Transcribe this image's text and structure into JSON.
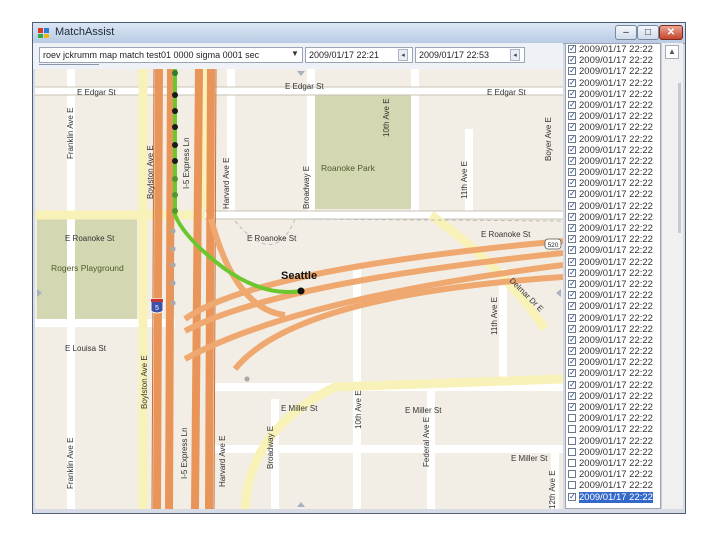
{
  "window": {
    "title": "MatchAssist"
  },
  "controls": {
    "file_combo_value": "roev jckrumm map match test01 0000 sigma 0001 sec",
    "start_time": "2009/01/17 22:21",
    "end_time": "2009/01/17 22:53",
    "minimize": "–",
    "maximize": "□",
    "close": "✕",
    "combo_arrow": "▼",
    "spin": "◂",
    "scroll_up": "▲"
  },
  "map_labels": {
    "e_edgar_st_1": "E Edgar St",
    "e_edgar_st_2": "E Edgar St",
    "e_edgar_st_3": "E Edgar St",
    "franklin_ave_e_1": "Franklin Ave E",
    "franklin_ave_e_2": "Franklin Ave E",
    "boylston_ave_e_1": "Boylston Ave E",
    "boylston_ave_e_2": "Boylston Ave E",
    "i5_express_ln_1": "I-5 Express Ln",
    "i5_express_ln_2": "I-5 Express Ln",
    "harvard_ave_e_1": "Harvard Ave E",
    "harvard_ave_e_2": "Harvard Ave E",
    "broadway_e_1": "Broadway E",
    "broadway_e_2": "Broadway E",
    "tenth_ave_e_1": "10th Ave E",
    "tenth_ave_e_2": "10th Ave E",
    "eleventh_ave_e_1": "11th Ave E",
    "eleventh_ave_e_2": "11th Ave E",
    "boyer_ave_e": "Boyer Ave E",
    "roanoke_park": "Roanoke Park",
    "e_roanoke_st_1": "E Roanoke St",
    "e_roanoke_st_2": "E Roanoke St",
    "e_roanoke_st_3": "E Roanoke St",
    "rogers_playground": "Rogers Playground",
    "seattle": "Seattle",
    "e_louisa_st": "E Louisa St",
    "e_miller_st_1": "E Miller St",
    "e_miller_st_2": "E Miller St",
    "e_miller_st_3": "E Miller St",
    "federal_ave_e": "Federal Ave E",
    "twelfth_ave_e": "12th Ave E",
    "delmar_dr_e": "Delmar Dr E",
    "sr520": "520",
    "i5": "5"
  },
  "timestamps": [
    {
      "label": "2009/01/17 22:22",
      "checked": true
    },
    {
      "label": "2009/01/17 22:22",
      "checked": true
    },
    {
      "label": "2009/01/17 22:22",
      "checked": true
    },
    {
      "label": "2009/01/17 22:22",
      "checked": true
    },
    {
      "label": "2009/01/17 22:22",
      "checked": true
    },
    {
      "label": "2009/01/17 22:22",
      "checked": true
    },
    {
      "label": "2009/01/17 22:22",
      "checked": true
    },
    {
      "label": "2009/01/17 22:22",
      "checked": true
    },
    {
      "label": "2009/01/17 22:22",
      "checked": true
    },
    {
      "label": "2009/01/17 22:22",
      "checked": true
    },
    {
      "label": "2009/01/17 22:22",
      "checked": true
    },
    {
      "label": "2009/01/17 22:22",
      "checked": true
    },
    {
      "label": "2009/01/17 22:22",
      "checked": true
    },
    {
      "label": "2009/01/17 22:22",
      "checked": true
    },
    {
      "label": "2009/01/17 22:22",
      "checked": true
    },
    {
      "label": "2009/01/17 22:22",
      "checked": true
    },
    {
      "label": "2009/01/17 22:22",
      "checked": true
    },
    {
      "label": "2009/01/17 22:22",
      "checked": true
    },
    {
      "label": "2009/01/17 22:22",
      "checked": true
    },
    {
      "label": "2009/01/17 22:22",
      "checked": true
    },
    {
      "label": "2009/01/17 22:22",
      "checked": true
    },
    {
      "label": "2009/01/17 22:22",
      "checked": true
    },
    {
      "label": "2009/01/17 22:22",
      "checked": true
    },
    {
      "label": "2009/01/17 22:22",
      "checked": true
    },
    {
      "label": "2009/01/17 22:22",
      "checked": true
    },
    {
      "label": "2009/01/17 22:22",
      "checked": true
    },
    {
      "label": "2009/01/17 22:22",
      "checked": true
    },
    {
      "label": "2009/01/17 22:22",
      "checked": true
    },
    {
      "label": "2009/01/17 22:22",
      "checked": true
    },
    {
      "label": "2009/01/17 22:22",
      "checked": true
    },
    {
      "label": "2009/01/17 22:22",
      "checked": true
    },
    {
      "label": "2009/01/17 22:22",
      "checked": true
    },
    {
      "label": "2009/01/17 22:22",
      "checked": true
    },
    {
      "label": "2009/01/17 22:22",
      "checked": false
    },
    {
      "label": "2009/01/17 22:22",
      "checked": false
    },
    {
      "label": "2009/01/17 22:22",
      "checked": false
    },
    {
      "label": "2009/01/17 22:22",
      "checked": false
    },
    {
      "label": "2009/01/17 22:22",
      "checked": false
    },
    {
      "label": "2009/01/17 22:22",
      "checked": false
    },
    {
      "label": "2009/01/17 22:22",
      "checked": false
    },
    {
      "label": "2009/01/17 22:22",
      "checked": true,
      "selected": true
    }
  ]
}
